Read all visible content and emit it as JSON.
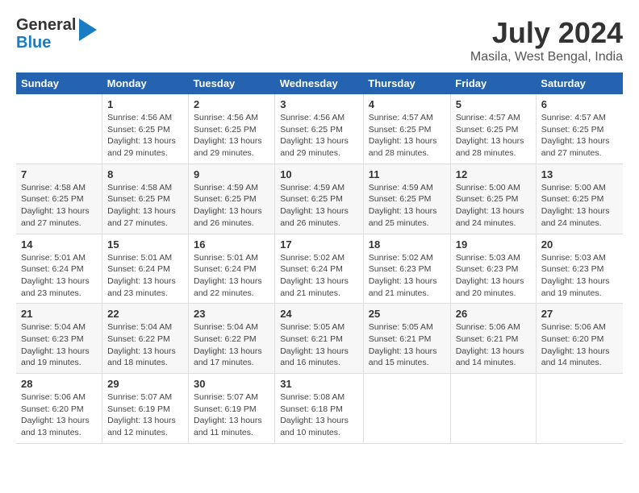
{
  "logo": {
    "line1": "General",
    "line2": "Blue"
  },
  "title": "July 2024",
  "subtitle": "Masila, West Bengal, India",
  "days_header": [
    "Sunday",
    "Monday",
    "Tuesday",
    "Wednesday",
    "Thursday",
    "Friday",
    "Saturday"
  ],
  "weeks": [
    [
      {
        "num": "",
        "sunrise": "",
        "sunset": "",
        "daylight": ""
      },
      {
        "num": "1",
        "sunrise": "Sunrise: 4:56 AM",
        "sunset": "Sunset: 6:25 PM",
        "daylight": "Daylight: 13 hours and 29 minutes."
      },
      {
        "num": "2",
        "sunrise": "Sunrise: 4:56 AM",
        "sunset": "Sunset: 6:25 PM",
        "daylight": "Daylight: 13 hours and 29 minutes."
      },
      {
        "num": "3",
        "sunrise": "Sunrise: 4:56 AM",
        "sunset": "Sunset: 6:25 PM",
        "daylight": "Daylight: 13 hours and 29 minutes."
      },
      {
        "num": "4",
        "sunrise": "Sunrise: 4:57 AM",
        "sunset": "Sunset: 6:25 PM",
        "daylight": "Daylight: 13 hours and 28 minutes."
      },
      {
        "num": "5",
        "sunrise": "Sunrise: 4:57 AM",
        "sunset": "Sunset: 6:25 PM",
        "daylight": "Daylight: 13 hours and 28 minutes."
      },
      {
        "num": "6",
        "sunrise": "Sunrise: 4:57 AM",
        "sunset": "Sunset: 6:25 PM",
        "daylight": "Daylight: 13 hours and 27 minutes."
      }
    ],
    [
      {
        "num": "7",
        "sunrise": "Sunrise: 4:58 AM",
        "sunset": "Sunset: 6:25 PM",
        "daylight": "Daylight: 13 hours and 27 minutes."
      },
      {
        "num": "8",
        "sunrise": "Sunrise: 4:58 AM",
        "sunset": "Sunset: 6:25 PM",
        "daylight": "Daylight: 13 hours and 27 minutes."
      },
      {
        "num": "9",
        "sunrise": "Sunrise: 4:59 AM",
        "sunset": "Sunset: 6:25 PM",
        "daylight": "Daylight: 13 hours and 26 minutes."
      },
      {
        "num": "10",
        "sunrise": "Sunrise: 4:59 AM",
        "sunset": "Sunset: 6:25 PM",
        "daylight": "Daylight: 13 hours and 26 minutes."
      },
      {
        "num": "11",
        "sunrise": "Sunrise: 4:59 AM",
        "sunset": "Sunset: 6:25 PM",
        "daylight": "Daylight: 13 hours and 25 minutes."
      },
      {
        "num": "12",
        "sunrise": "Sunrise: 5:00 AM",
        "sunset": "Sunset: 6:25 PM",
        "daylight": "Daylight: 13 hours and 24 minutes."
      },
      {
        "num": "13",
        "sunrise": "Sunrise: 5:00 AM",
        "sunset": "Sunset: 6:25 PM",
        "daylight": "Daylight: 13 hours and 24 minutes."
      }
    ],
    [
      {
        "num": "14",
        "sunrise": "Sunrise: 5:01 AM",
        "sunset": "Sunset: 6:24 PM",
        "daylight": "Daylight: 13 hours and 23 minutes."
      },
      {
        "num": "15",
        "sunrise": "Sunrise: 5:01 AM",
        "sunset": "Sunset: 6:24 PM",
        "daylight": "Daylight: 13 hours and 23 minutes."
      },
      {
        "num": "16",
        "sunrise": "Sunrise: 5:01 AM",
        "sunset": "Sunset: 6:24 PM",
        "daylight": "Daylight: 13 hours and 22 minutes."
      },
      {
        "num": "17",
        "sunrise": "Sunrise: 5:02 AM",
        "sunset": "Sunset: 6:24 PM",
        "daylight": "Daylight: 13 hours and 21 minutes."
      },
      {
        "num": "18",
        "sunrise": "Sunrise: 5:02 AM",
        "sunset": "Sunset: 6:23 PM",
        "daylight": "Daylight: 13 hours and 21 minutes."
      },
      {
        "num": "19",
        "sunrise": "Sunrise: 5:03 AM",
        "sunset": "Sunset: 6:23 PM",
        "daylight": "Daylight: 13 hours and 20 minutes."
      },
      {
        "num": "20",
        "sunrise": "Sunrise: 5:03 AM",
        "sunset": "Sunset: 6:23 PM",
        "daylight": "Daylight: 13 hours and 19 minutes."
      }
    ],
    [
      {
        "num": "21",
        "sunrise": "Sunrise: 5:04 AM",
        "sunset": "Sunset: 6:23 PM",
        "daylight": "Daylight: 13 hours and 19 minutes."
      },
      {
        "num": "22",
        "sunrise": "Sunrise: 5:04 AM",
        "sunset": "Sunset: 6:22 PM",
        "daylight": "Daylight: 13 hours and 18 minutes."
      },
      {
        "num": "23",
        "sunrise": "Sunrise: 5:04 AM",
        "sunset": "Sunset: 6:22 PM",
        "daylight": "Daylight: 13 hours and 17 minutes."
      },
      {
        "num": "24",
        "sunrise": "Sunrise: 5:05 AM",
        "sunset": "Sunset: 6:21 PM",
        "daylight": "Daylight: 13 hours and 16 minutes."
      },
      {
        "num": "25",
        "sunrise": "Sunrise: 5:05 AM",
        "sunset": "Sunset: 6:21 PM",
        "daylight": "Daylight: 13 hours and 15 minutes."
      },
      {
        "num": "26",
        "sunrise": "Sunrise: 5:06 AM",
        "sunset": "Sunset: 6:21 PM",
        "daylight": "Daylight: 13 hours and 14 minutes."
      },
      {
        "num": "27",
        "sunrise": "Sunrise: 5:06 AM",
        "sunset": "Sunset: 6:20 PM",
        "daylight": "Daylight: 13 hours and 14 minutes."
      }
    ],
    [
      {
        "num": "28",
        "sunrise": "Sunrise: 5:06 AM",
        "sunset": "Sunset: 6:20 PM",
        "daylight": "Daylight: 13 hours and 13 minutes."
      },
      {
        "num": "29",
        "sunrise": "Sunrise: 5:07 AM",
        "sunset": "Sunset: 6:19 PM",
        "daylight": "Daylight: 13 hours and 12 minutes."
      },
      {
        "num": "30",
        "sunrise": "Sunrise: 5:07 AM",
        "sunset": "Sunset: 6:19 PM",
        "daylight": "Daylight: 13 hours and 11 minutes."
      },
      {
        "num": "31",
        "sunrise": "Sunrise: 5:08 AM",
        "sunset": "Sunset: 6:18 PM",
        "daylight": "Daylight: 13 hours and 10 minutes."
      },
      {
        "num": "",
        "sunrise": "",
        "sunset": "",
        "daylight": ""
      },
      {
        "num": "",
        "sunrise": "",
        "sunset": "",
        "daylight": ""
      },
      {
        "num": "",
        "sunrise": "",
        "sunset": "",
        "daylight": ""
      }
    ]
  ]
}
